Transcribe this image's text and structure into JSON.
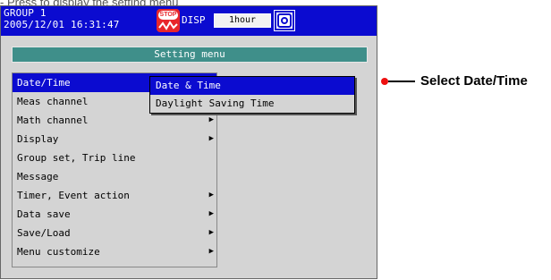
{
  "top_caption": "- Press to display the setting menu",
  "header": {
    "group": "GROUP 1",
    "datetime": "2005/12/01 16:31:47",
    "status_badge": "STOP",
    "disp_label": "DISP",
    "interval": "1hour"
  },
  "setting_menu_title": "Setting menu",
  "menu": {
    "items": [
      {
        "label": "Date/Time",
        "selected": true,
        "has_submenu": true
      },
      {
        "label": "Meas channel",
        "selected": false,
        "has_submenu": true
      },
      {
        "label": "Math channel",
        "selected": false,
        "has_submenu": true
      },
      {
        "label": "Display",
        "selected": false,
        "has_submenu": true
      },
      {
        "label": "Group set, Trip line",
        "selected": false,
        "has_submenu": false
      },
      {
        "label": "Message",
        "selected": false,
        "has_submenu": false
      },
      {
        "label": "Timer, Event action",
        "selected": false,
        "has_submenu": true
      },
      {
        "label": "Data save",
        "selected": false,
        "has_submenu": true
      },
      {
        "label": "Save/Load",
        "selected": false,
        "has_submenu": true
      },
      {
        "label": "Menu customize",
        "selected": false,
        "has_submenu": true
      }
    ]
  },
  "submenu": {
    "items": [
      {
        "label": "Date & Time",
        "selected": true
      },
      {
        "label": "Daylight Saving Time",
        "selected": false
      }
    ]
  },
  "callout": "Select Date/Time",
  "colors": {
    "header_bg": "#0b0bd0",
    "selection_bg": "#0b0bd0",
    "title_bar_bg": "#3f8f8a",
    "screen_bg": "#d4d4d4",
    "stop_badge": "#e8262b",
    "callout_dot": "#e11111"
  },
  "icons": {
    "submenu_arrow": "triangle-right",
    "display_mode": "target-icon"
  }
}
